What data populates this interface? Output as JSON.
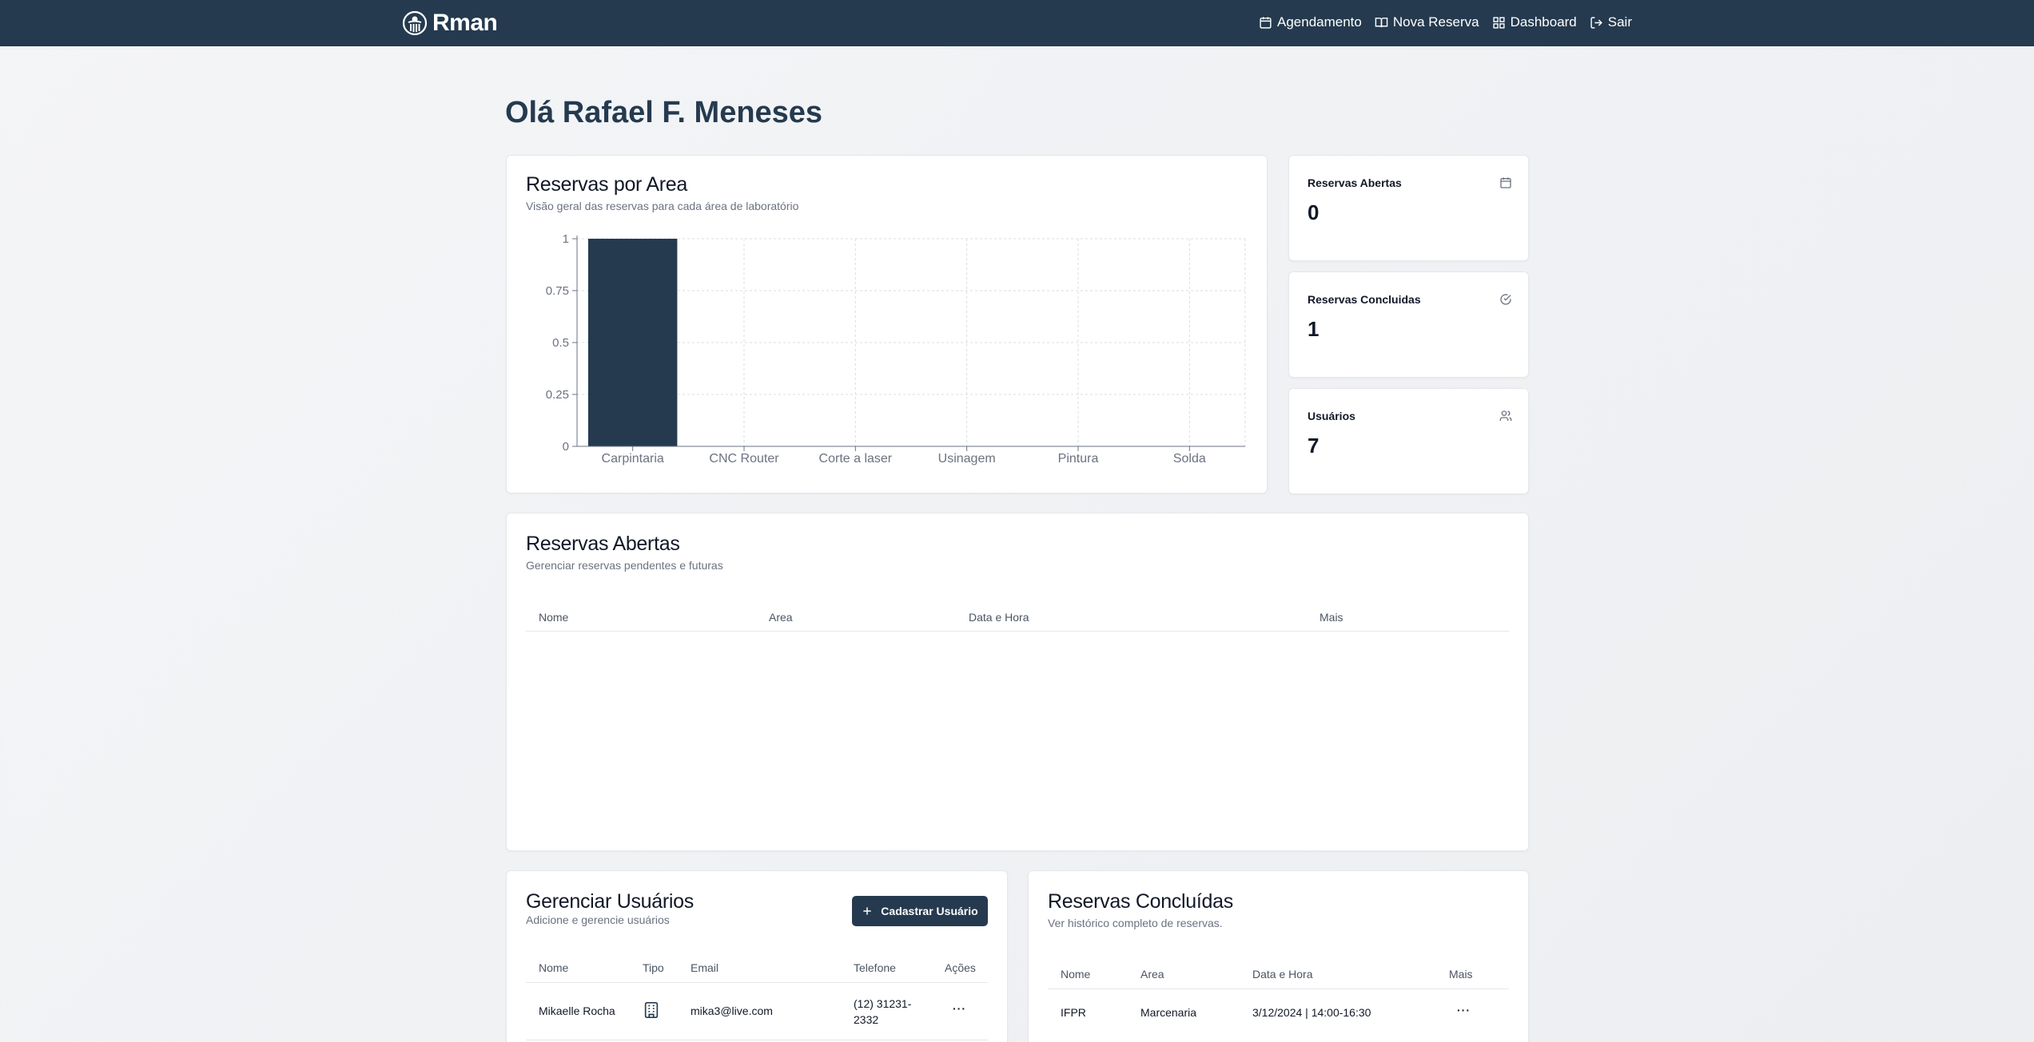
{
  "brand": {
    "name": "Rman"
  },
  "nav": [
    {
      "label": "Agendamento",
      "icon": "calendar-icon"
    },
    {
      "label": "Nova Reserva",
      "icon": "book-open-icon"
    },
    {
      "label": "Dashboard",
      "icon": "grid-icon"
    },
    {
      "label": "Sair",
      "icon": "logout-icon"
    }
  ],
  "greeting": "Olá Rafael F. Meneses",
  "chart_card": {
    "title": "Reservas por Area",
    "subtitle": "Visão geral das reservas para cada área de laboratório"
  },
  "chart_data": {
    "type": "bar",
    "categories": [
      "Carpintaria",
      "CNC Router",
      "Corte a laser",
      "Usinagem",
      "Pintura",
      "Solda"
    ],
    "values": [
      1,
      0,
      0,
      0,
      0,
      0
    ],
    "ylim": [
      0,
      1
    ],
    "yticks": [
      "0",
      "0.25",
      "0.5",
      "0.75",
      "1"
    ],
    "grid": true,
    "bar_color": "#253a4f"
  },
  "stats": [
    {
      "label": "Reservas Abertas",
      "value": "0",
      "icon": "calendar-icon"
    },
    {
      "label": "Reservas Concluidas",
      "value": "1",
      "icon": "check-circle-icon"
    },
    {
      "label": "Usuários",
      "value": "7",
      "icon": "users-icon"
    }
  ],
  "open_reservations": {
    "title": "Reservas Abertas",
    "subtitle": "Gerenciar reservas pendentes e futuras",
    "columns": [
      "Nome",
      "Area",
      "Data e Hora",
      "Mais"
    ]
  },
  "users": {
    "title": "Gerenciar Usuários",
    "subtitle": "Adicione e gerencie usuários",
    "add_button": "Cadastrar Usuário",
    "columns": [
      "Nome",
      "Tipo",
      "Email",
      "Telefone",
      "Ações"
    ],
    "rows": [
      {
        "name": "Mikaelle Rocha",
        "type_icon": "building-icon",
        "email": "mika3@live.com",
        "phone_1": "(12) 31231-",
        "phone_2": "2332",
        "actions": "···"
      }
    ]
  },
  "done_reservations": {
    "title": "Reservas Concluídas",
    "subtitle": "Ver histórico completo de reservas.",
    "columns": [
      "Nome",
      "Area",
      "Data e Hora",
      "Mais"
    ],
    "rows": [
      {
        "name": "IFPR",
        "area": "Marcenaria",
        "datetime": "3/12/2024 | 14:00-16:30",
        "more": "···"
      }
    ]
  },
  "colors": {
    "primary": "#253a4f",
    "muted": "#6b7280"
  }
}
